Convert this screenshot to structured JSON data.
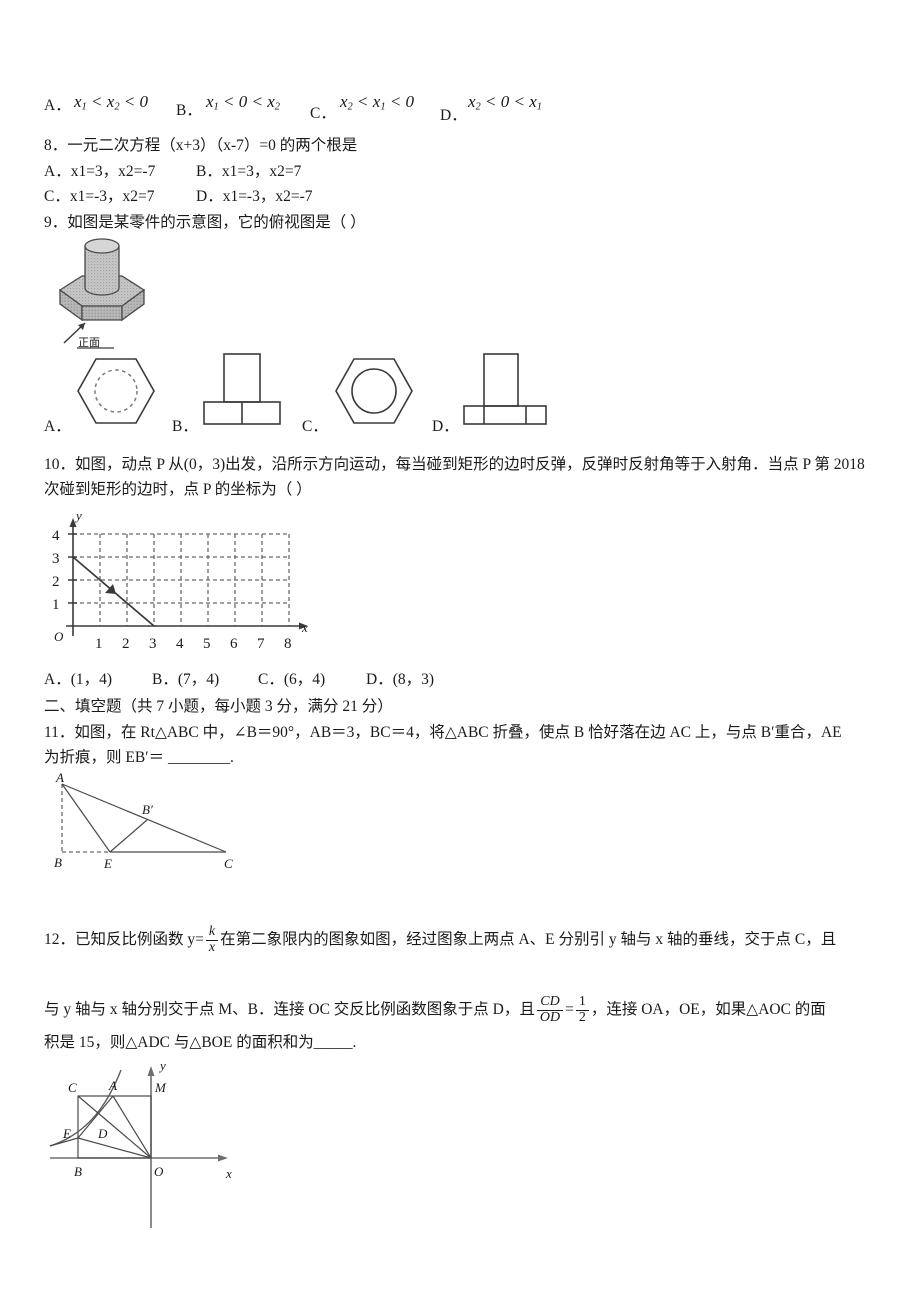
{
  "q7_options": {
    "a_label": "A．",
    "a_expr": {
      "lhs": "x",
      "lhs_sub": "1",
      "op1": "<",
      "mid": "x",
      "mid_sub": "2",
      "op2": "<",
      "rhs": "0"
    },
    "b_label": "B．",
    "b_expr": {
      "lhs": "x",
      "lhs_sub": "1",
      "op1": "<",
      "mid": "0",
      "op2": "<",
      "rhs": "x",
      "rhs_sub": "2"
    },
    "c_label": "C．",
    "c_expr": {
      "lhs": "x",
      "lhs_sub": "2",
      "op1": "<",
      "mid": "x",
      "mid_sub": "1",
      "op2": "<",
      "rhs": "0"
    },
    "d_label": "D．",
    "d_expr": {
      "lhs": "x",
      "lhs_sub": "2",
      "op1": "<",
      "mid": "0",
      "op2": "<",
      "rhs": "x",
      "rhs_sub": "1"
    }
  },
  "q8": {
    "stem": "8．一元二次方程（x+3）（x-7）=0 的两个根是",
    "opt_a": "A．x1=3，x2=-7",
    "opt_b": "B．x1=3，x2=7",
    "opt_c": "C．x1=-3，x2=7",
    "opt_d": "D．x1=-3，x2=-7"
  },
  "q9": {
    "stem": "9．如图是某零件的示意图，它的俯视图是（      ）",
    "front_label": "正面",
    "opt_a_label": "A．",
    "opt_b_label": "B．",
    "opt_c_label": "C．",
    "opt_d_label": "D．",
    "figure_desc": "hexagonal-base-with-cylinder"
  },
  "q10": {
    "stem_line1": "10．如图，动点 P 从(0，3)出发，沿所示方向运动，每当碰到矩形的边时反弹，反弹时反射角等于入射角．当点 P 第 2018",
    "stem_line2": "次碰到矩形的边时，点 P 的坐标为（      ）",
    "opt_a": "A．(1，4)",
    "opt_b": "B．(7，4)",
    "opt_c": "C．(6，4)",
    "opt_d": "D．(8，3)"
  },
  "q10_graph": {
    "x_label": "x",
    "y_label": "y",
    "origin_label": "O",
    "x_ticks": [
      "1",
      "2",
      "3",
      "4",
      "5",
      "6",
      "7",
      "8"
    ],
    "y_ticks": [
      "1",
      "2",
      "3",
      "4"
    ],
    "x_range": [
      0,
      8
    ],
    "y_range": [
      0,
      4
    ],
    "ray_start": [
      0,
      3
    ],
    "ray_end": [
      3,
      0
    ],
    "grid": "dashed"
  },
  "section2": {
    "heading": "二、填空题（共 7 小题，每小题 3 分，满分 21 分）"
  },
  "q11": {
    "stem_line1": "11．如图，在 Rt△ABC 中，∠B＝90°，AB＝3，BC＝4，将△ABC 折叠，使点 B 恰好落在边 AC 上，与点 B′重合，AE",
    "stem_line2": "为折痕，则 EB′＝ ________.",
    "labels": {
      "a": "A",
      "b": "B",
      "c": "C",
      "e": "E",
      "bprime": "B′"
    }
  },
  "q12": {
    "stem_pre": "12．已知反比例函数 y=",
    "frac1_num": "k",
    "frac1_den": "x",
    "stem_post": "在第二象限内的图象如图，经过图象上两点 A、E 分别引 y 轴与 x 轴的垂线，交于点 C，且",
    "line2_pre": "与 y 轴与 x 轴分别交于点 M、B．连接 OC 交反比例函数图象于点 D，且",
    "frac2_num": "CD",
    "frac2_den": "OD",
    "frac2_eq": "=",
    "frac2_rnum": "1",
    "frac2_rden": "2",
    "line2_post": "，连接 OA，OE，如果△AOC 的面",
    "line3": "积是 15，则△ADC 与△BOE 的面积和为_____."
  },
  "q12_graph": {
    "x_label": "x",
    "y_label": "y",
    "labels": {
      "o": "O",
      "a": "A",
      "b": "B",
      "c": "C",
      "d": "D",
      "e": "E",
      "m": "M"
    },
    "quadrant": "second",
    "curve": "hyperbola"
  }
}
